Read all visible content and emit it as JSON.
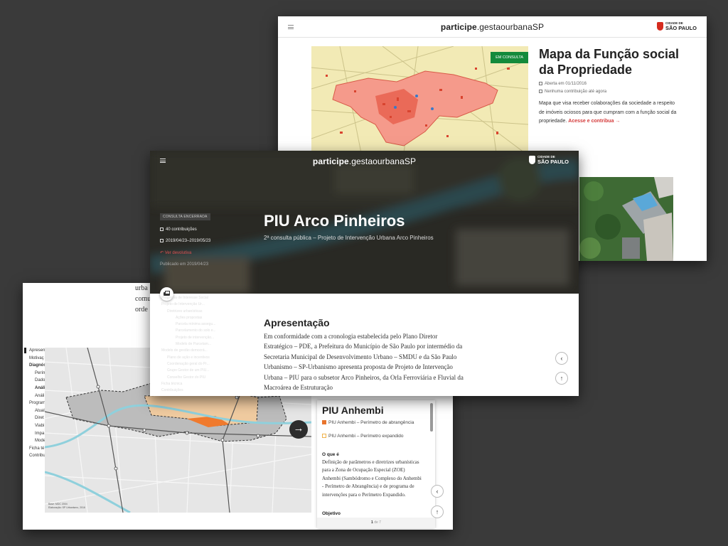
{
  "screenA": {
    "brand_bold": "participe",
    "brand_rest": ".gestaourbanaSP",
    "city_line1": "CIDADE DE",
    "city_line2": "SÃO PAULO",
    "badge": "EM CONSULTA",
    "title": "Mapa da Função social da Propriedade",
    "opened": "Aberta em 01/11/2016",
    "contributions": "Nenhuma contribuição até agora",
    "description": "Mapa que visa receber colaborações da sociedade a respeito de imóveis ociosos para que cumpram com a função social da propriedade.",
    "cta": "Acesse e contribua →"
  },
  "screenB": {
    "text_lines": [
      "urba",
      "comu",
      "orde"
    ],
    "toc": [
      "Apresen",
      "Motivaç",
      "Diagnós",
      "Perím",
      "Dado",
      "Análi",
      "Análi",
      "Program",
      "Atual",
      "Diret",
      "Viabi",
      "Impa",
      "Mode",
      "Ficha té",
      "Contribu"
    ],
    "map_credits_1": "Base: MDC 2004",
    "map_credits_2": "Elaboração: SP Urbanismo, 2016",
    "panel_title": "PIU Anhembi",
    "legend_1": "PIU Anhembi – Perímetro de abrangência",
    "legend_2": "PIU Anhembi – Perímetro expandido",
    "legend_1_color": "#e8742d",
    "legend_2_color": "#f0b24a",
    "what_title": "O que é",
    "what_text": "Definição de parâmetros e diretrizes urbanísticas para a Zona de Ocupação Especial (ZOE) Anhembi (Sambódromo e Complexo do Anhembi - Perímetro de Abrangência) e de programa de intervenções para o Perímetro Expandido.",
    "objective_title": "Objetivo",
    "pager_current": "1",
    "pager_rest": " de 7"
  },
  "screenC": {
    "brand_bold": "participe",
    "brand_rest": ".gestaourbanaSP",
    "city_line1": "CIDADE DE",
    "city_line2": "SÃO PAULO",
    "status": "CONSULTA ENCERRADA",
    "contributions": "40 contribuições",
    "dates": "2019/04/23–2019/05/23",
    "returns_link": "Ver devolutiva",
    "published": "Publicado em 2019/04/23",
    "title": "PIU Arco Pinheiros",
    "subtitle": "2ª consulta pública – Projeto de Intervenção Urbana Arco Pinheiros",
    "toc": [
      {
        "t": "Programa de Interesse Social",
        "l": "s1"
      },
      {
        "t": "Projeto de Intervenção Ur...",
        "l": "s1"
      },
      {
        "t": "Diretrizes urbanísticas",
        "l": "s2"
      },
      {
        "t": "Ações propostas",
        "l": "s3"
      },
      {
        "t": "Parcela mínima assegu...",
        "l": "s3"
      },
      {
        "t": "Parcelamento do solo e...",
        "l": "s3"
      },
      {
        "t": "Projeto de intervenção...",
        "l": "s3"
      },
      {
        "t": "Modelo de Parcelam...",
        "l": "s3"
      },
      {
        "t": "Modelo de gestão democrá...",
        "l": "s1"
      },
      {
        "t": "Plano de ação e incentivos",
        "l": "s2"
      },
      {
        "t": "Coordenação geral do Pr...",
        "l": "s2"
      },
      {
        "t": "Grupo Gestor de um PIU...",
        "l": "s2"
      },
      {
        "t": "Conselho Gestor do PIU",
        "l": "s2"
      },
      {
        "t": "Ficha técnica",
        "l": "s1"
      },
      {
        "t": "Contribuições",
        "l": "s1"
      }
    ],
    "section_title": "Apresentação",
    "body": "Em conformidade com a cronologia estabelecida pelo Plano Diretor Estratégico – PDE, a Prefeitura do Município de São Paulo por intermédio da Secretaria Municipal de Desenvolvimento Urbano – SMDU e da São Paulo Urbanismo – SP-Urbanismo apresenta proposta de Projeto de Intervenção Urbana – PIU para o subsetor Arco Pinheiros, da Orla Ferroviária e Fluvial da Macroárea de Estruturação"
  },
  "colors": {
    "background": "#3a3a3a",
    "badge_green": "#138a3b",
    "accent_red": "#d43b3b",
    "map_pink": "#f07d6b"
  }
}
